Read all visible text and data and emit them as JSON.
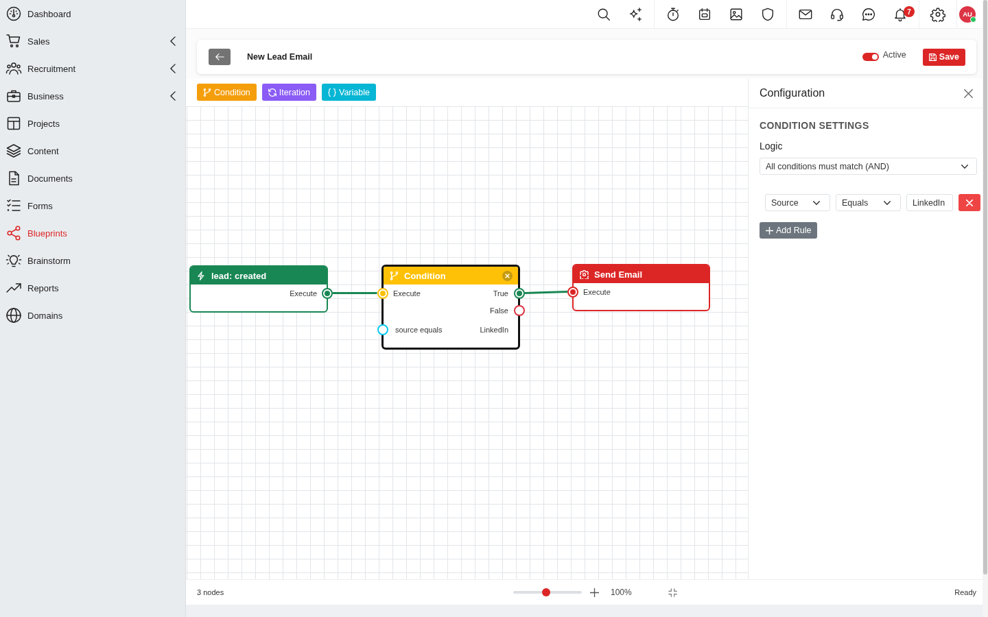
{
  "sidebar": {
    "items": [
      {
        "label": "Dashboard",
        "selected": false,
        "has_submenu": false
      },
      {
        "label": "Sales",
        "selected": false,
        "has_submenu": true
      },
      {
        "label": "Recruitment",
        "selected": false,
        "has_submenu": true
      },
      {
        "label": "Business",
        "selected": false,
        "has_submenu": true
      },
      {
        "label": "Projects",
        "selected": false,
        "has_submenu": false
      },
      {
        "label": "Content",
        "selected": false,
        "has_submenu": false
      },
      {
        "label": "Documents",
        "selected": false,
        "has_submenu": false
      },
      {
        "label": "Forms",
        "selected": false,
        "has_submenu": false
      },
      {
        "label": "Blueprints",
        "selected": true,
        "has_submenu": false
      },
      {
        "label": "Brainstorm",
        "selected": false,
        "has_submenu": false
      },
      {
        "label": "Reports",
        "selected": false,
        "has_submenu": false
      },
      {
        "label": "Domains",
        "selected": false,
        "has_submenu": false
      }
    ]
  },
  "topbar": {
    "notification_count": "7",
    "avatar": {
      "initials": "AU",
      "online": true
    }
  },
  "header": {
    "title": "New Lead Email",
    "status": {
      "label": "Active",
      "on": true
    },
    "save_label": "Save"
  },
  "palette": [
    {
      "label": "Condition",
      "color": "#f59e0b"
    },
    {
      "label": "Iteration",
      "color": "#8b5cf6"
    },
    {
      "label": "Variable",
      "color": "#06b6d4"
    }
  ],
  "canvas": {
    "nodes": [
      {
        "kind": "trigger",
        "title": "lead: created",
        "color": "#198754",
        "selected": false,
        "rows": [
          {
            "right": {
              "label": "Execute",
              "port": {
                "color": "#198754",
                "connected": true
              }
            }
          }
        ]
      },
      {
        "kind": "condition",
        "title": "Condition",
        "color": "#ffc107",
        "selected": true,
        "rows": [
          {
            "left": {
              "label": "Execute",
              "port": {
                "color": "#ffc107",
                "connected": true
              }
            },
            "right": {
              "label": "True",
              "port": {
                "color": "#198754",
                "connected": true
              }
            }
          },
          {
            "right": {
              "label": "False",
              "port": {
                "color": "#dc3545",
                "connected": false
              }
            }
          },
          {
            "left": {
              "label": "source equals",
              "port": {
                "color": "#0dcaf0",
                "connected": false
              }
            },
            "right": {
              "label": "LinkedIn"
            }
          }
        ]
      },
      {
        "kind": "action",
        "title": "Send Email",
        "color": "#dc2626",
        "selected": false,
        "rows": [
          {
            "left": {
              "label": "Execute",
              "port": {
                "color": "#dc2626",
                "connected": true
              }
            }
          }
        ]
      }
    ]
  },
  "config": {
    "title": "Configuration",
    "section": "CONDITION SETTINGS",
    "logic_label": "Logic",
    "logic_value": "All conditions must match (AND)",
    "rules": [
      {
        "field": "Source",
        "operator": "Equals",
        "value": "LinkedIn"
      }
    ],
    "add_rule_label": "Add Rule"
  },
  "status_bar": {
    "node_count": "3 nodes",
    "zoom": {
      "level": 0.48,
      "label": "100%"
    },
    "status": "Ready"
  }
}
